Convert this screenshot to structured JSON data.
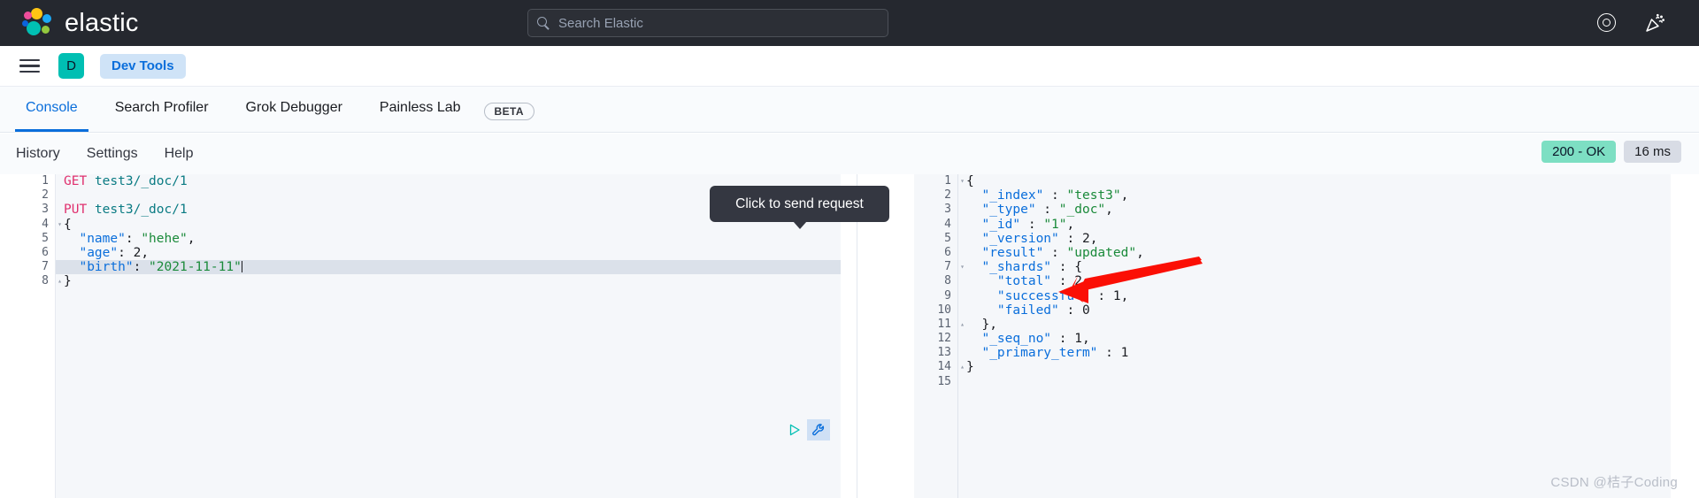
{
  "topbar": {
    "brand": "elastic",
    "brand_logo_icon": "elastic-logo-icon",
    "search": {
      "placeholder": "Search Elastic",
      "icon": "search-icon"
    },
    "help_icon": "lifebuoy-help-icon",
    "whats_new_icon": "confetti-celebration-icon"
  },
  "navbar": {
    "menu_icon": "hamburger-menu-icon",
    "space_avatar": "D",
    "breadcrumb": "Dev Tools"
  },
  "tabs": [
    {
      "label": "Console",
      "active": true
    },
    {
      "label": "Search Profiler",
      "active": false
    },
    {
      "label": "Grok Debugger",
      "active": false
    },
    {
      "label": "Painless Lab",
      "active": false
    }
  ],
  "beta_badge": "BETA",
  "subbar": {
    "links": [
      "History",
      "Settings",
      "Help"
    ],
    "status_code": "200 - OK",
    "duration": "16 ms"
  },
  "tooltip": {
    "text": "Click to send request"
  },
  "editor": {
    "play_icon": "play-send-request-icon",
    "wrench_icon": "wrench-settings-icon",
    "highlighted_line": 7,
    "lines": [
      {
        "n": "1",
        "fold": "",
        "tokens": [
          {
            "t": "method",
            "v": "GET"
          },
          {
            "t": "punc",
            "v": " "
          },
          {
            "t": "url",
            "v": "test3/_doc/1"
          }
        ]
      },
      {
        "n": "2",
        "fold": "",
        "tokens": []
      },
      {
        "n": "3",
        "fold": "",
        "tokens": [
          {
            "t": "method",
            "v": "PUT"
          },
          {
            "t": "punc",
            "v": " "
          },
          {
            "t": "url",
            "v": "test3/_doc/1"
          }
        ]
      },
      {
        "n": "4",
        "fold": "▾",
        "tokens": [
          {
            "t": "punc",
            "v": "{"
          }
        ]
      },
      {
        "n": "5",
        "fold": "",
        "tokens": [
          {
            "t": "key",
            "v": "  \"name\""
          },
          {
            "t": "punc",
            "v": ": "
          },
          {
            "t": "str",
            "v": "\"hehe\""
          },
          {
            "t": "punc",
            "v": ","
          }
        ]
      },
      {
        "n": "6",
        "fold": "",
        "tokens": [
          {
            "t": "key",
            "v": "  \"age\""
          },
          {
            "t": "punc",
            "v": ": "
          },
          {
            "t": "num",
            "v": "2"
          },
          {
            "t": "punc",
            "v": ","
          }
        ]
      },
      {
        "n": "7",
        "fold": "",
        "tokens": [
          {
            "t": "key",
            "v": "  \"birth\""
          },
          {
            "t": "punc",
            "v": ": "
          },
          {
            "t": "str",
            "v": "\"2021-11-11\""
          },
          {
            "t": "caret",
            "v": ""
          }
        ]
      },
      {
        "n": "8",
        "fold": "▴",
        "tokens": [
          {
            "t": "punc",
            "v": "}"
          }
        ]
      }
    ]
  },
  "response": {
    "lines": [
      {
        "n": "1",
        "fold": "▾",
        "tokens": [
          {
            "t": "punc",
            "v": "{"
          }
        ]
      },
      {
        "n": "2",
        "fold": "",
        "tokens": [
          {
            "t": "key",
            "v": "  \"_index\""
          },
          {
            "t": "punc",
            "v": " : "
          },
          {
            "t": "str",
            "v": "\"test3\""
          },
          {
            "t": "punc",
            "v": ","
          }
        ]
      },
      {
        "n": "3",
        "fold": "",
        "tokens": [
          {
            "t": "key",
            "v": "  \"_type\""
          },
          {
            "t": "punc",
            "v": " : "
          },
          {
            "t": "str",
            "v": "\"_doc\""
          },
          {
            "t": "punc",
            "v": ","
          }
        ]
      },
      {
        "n": "4",
        "fold": "",
        "tokens": [
          {
            "t": "key",
            "v": "  \"_id\""
          },
          {
            "t": "punc",
            "v": " : "
          },
          {
            "t": "str",
            "v": "\"1\""
          },
          {
            "t": "punc",
            "v": ","
          }
        ]
      },
      {
        "n": "5",
        "fold": "",
        "tokens": [
          {
            "t": "key",
            "v": "  \"_version\""
          },
          {
            "t": "punc",
            "v": " : "
          },
          {
            "t": "num",
            "v": "2"
          },
          {
            "t": "punc",
            "v": ","
          }
        ]
      },
      {
        "n": "6",
        "fold": "",
        "tokens": [
          {
            "t": "key",
            "v": "  \"result\""
          },
          {
            "t": "punc",
            "v": " : "
          },
          {
            "t": "str",
            "v": "\"updated\""
          },
          {
            "t": "punc",
            "v": ","
          }
        ]
      },
      {
        "n": "7",
        "fold": "▾",
        "tokens": [
          {
            "t": "key",
            "v": "  \"_shards\""
          },
          {
            "t": "punc",
            "v": " : {"
          }
        ]
      },
      {
        "n": "8",
        "fold": "",
        "tokens": [
          {
            "t": "key",
            "v": "    \"total\""
          },
          {
            "t": "punc",
            "v": " : "
          },
          {
            "t": "num",
            "v": "2"
          },
          {
            "t": "punc",
            "v": ","
          }
        ]
      },
      {
        "n": "9",
        "fold": "",
        "tokens": [
          {
            "t": "key",
            "v": "    \"successful\""
          },
          {
            "t": "punc",
            "v": " : "
          },
          {
            "t": "num",
            "v": "1"
          },
          {
            "t": "punc",
            "v": ","
          }
        ]
      },
      {
        "n": "10",
        "fold": "",
        "tokens": [
          {
            "t": "key",
            "v": "    \"failed\""
          },
          {
            "t": "punc",
            "v": " : "
          },
          {
            "t": "num",
            "v": "0"
          }
        ]
      },
      {
        "n": "11",
        "fold": "▴",
        "tokens": [
          {
            "t": "punc",
            "v": "  },"
          }
        ]
      },
      {
        "n": "12",
        "fold": "",
        "tokens": [
          {
            "t": "key",
            "v": "  \"_seq_no\""
          },
          {
            "t": "punc",
            "v": " : "
          },
          {
            "t": "num",
            "v": "1"
          },
          {
            "t": "punc",
            "v": ","
          }
        ]
      },
      {
        "n": "13",
        "fold": "",
        "tokens": [
          {
            "t": "key",
            "v": "  \"_primary_term\""
          },
          {
            "t": "punc",
            "v": " : "
          },
          {
            "t": "num",
            "v": "1"
          }
        ]
      },
      {
        "n": "14",
        "fold": "▴",
        "tokens": [
          {
            "t": "punc",
            "v": "}"
          }
        ]
      },
      {
        "n": "15",
        "fold": "",
        "tokens": []
      }
    ]
  },
  "annotation": {
    "arrow_color": "#fb0f05"
  },
  "watermark": "CSDN @桔子Coding",
  "colors": {
    "topbar_bg": "#25282f",
    "accent_blue": "#0a6edb",
    "teal": "#00bfb3",
    "status_green": "#7ddfc3",
    "panel_bg": "#f5f7fa"
  }
}
